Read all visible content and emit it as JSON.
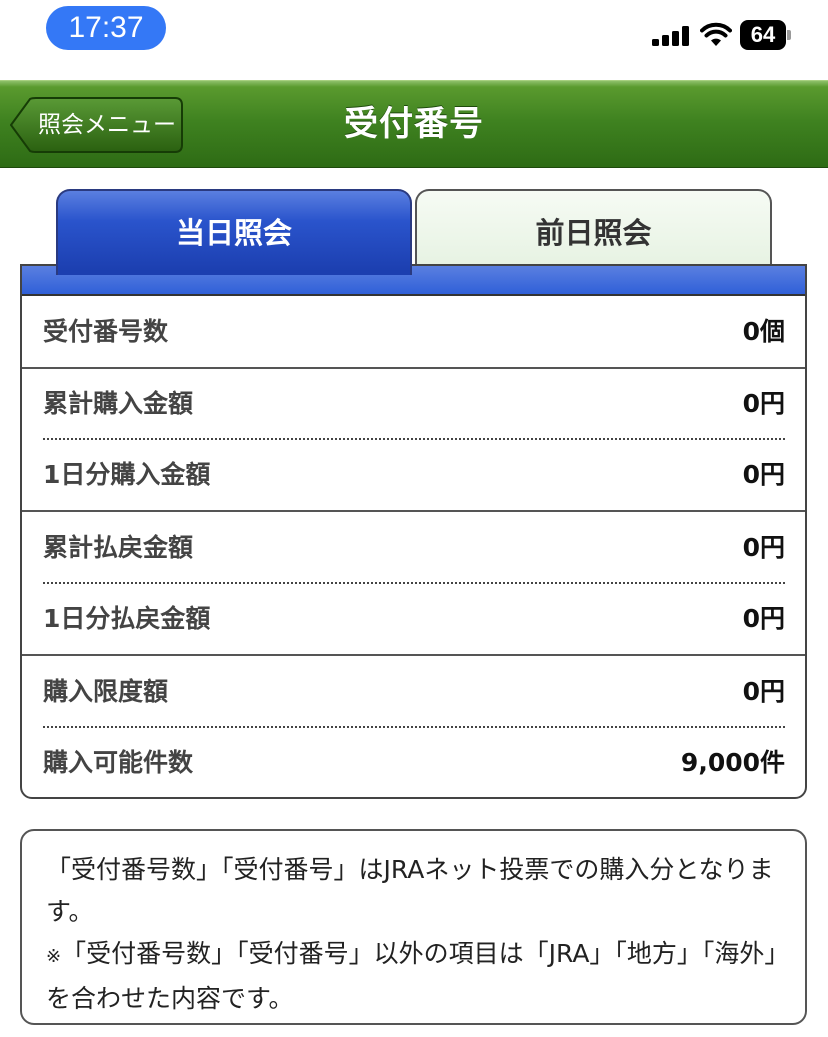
{
  "status_bar": {
    "time": "17:37",
    "battery": "64"
  },
  "nav": {
    "back_label": "照会メニュー",
    "title": "受付番号"
  },
  "tabs": [
    {
      "label": "当日照会",
      "active": true
    },
    {
      "label": "前日照会",
      "active": false
    }
  ],
  "rows": [
    {
      "label": "受付番号数",
      "value": "0個"
    },
    {
      "label": "累計購入金額",
      "value": "0円"
    },
    {
      "label": "1日分購入金額",
      "value": "0円"
    },
    {
      "label": "累計払戻金額",
      "value": "0円"
    },
    {
      "label": "1日分払戻金額",
      "value": "0円"
    },
    {
      "label": "購入限度額",
      "value": "0円"
    },
    {
      "label": "購入可能件数",
      "value": "9,000件"
    }
  ],
  "note": {
    "line1": "「受付番号数」「受付番号」はJRAネット投票での購入分となります。",
    "mark": "※",
    "line2": "「受付番号数」「受付番号」以外の項目は「JRA」「地方」「海外」を合わせた内容です。"
  },
  "colors": {
    "nav_green": "#3f8220",
    "tab_blue": "#2a54cc",
    "status_time_pill": "#3478f6"
  }
}
